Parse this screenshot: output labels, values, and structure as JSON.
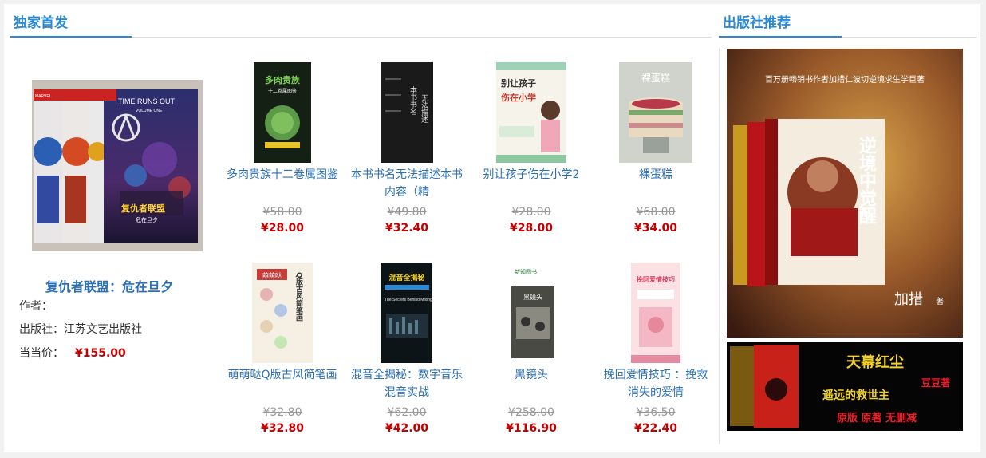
{
  "sections": {
    "exclusive_title": "独家首发",
    "publisher_title": "出版社推荐"
  },
  "feature": {
    "title": "复仇者联盟：危在旦夕",
    "author_label": "作者：",
    "author_value": "",
    "publisher_label": "出版社：",
    "publisher_value": "江苏文艺出版社",
    "price_label": "当当价：",
    "price": "¥155.00",
    "cover_text": {
      "brand": "MARVEL",
      "headline": "TIME RUNS OUT",
      "volume": "VOLUME ONE",
      "cn_title": "复仇者联盟",
      "cn_sub": "危在旦夕"
    }
  },
  "books": [
    {
      "name": "多肉贵族十二卷属图鉴",
      "old_price": "¥58.00",
      "price": "¥28.00",
      "cover_title": "多肉贵族",
      "cover_sub": "十二卷属图鉴",
      "color": "#152015",
      "accent": "#74b35a"
    },
    {
      "name": "本书书名无法描述本书内容（精",
      "old_price": "¥49.80",
      "price": "¥32.40",
      "cover_title": "本书书名",
      "cover_sub": "无法描述",
      "color": "#1a1a1a",
      "accent": "#dddddd"
    },
    {
      "name": "别让孩子伤在小学2",
      "old_price": "¥28.00",
      "price": "¥28.00",
      "cover_title": "别让孩子",
      "cover_sub": "伤在小学",
      "color": "#f6f3ea",
      "accent": "#c0392b"
    },
    {
      "name": "裸蛋糕",
      "old_price": "¥68.00",
      "price": "¥34.00",
      "cover_title": "裸蛋糕",
      "cover_sub": "",
      "color": "#cfd3cc",
      "accent": "#ffffff"
    },
    {
      "name": "萌萌哒Q版古风简笔画",
      "old_price": "¥32.80",
      "price": "¥32.80",
      "cover_title": "Q版古风简笔画",
      "cover_sub": "萌萌哒",
      "color": "#f6efe4",
      "accent": "#b0303a"
    },
    {
      "name": "混音全揭秘：数字音乐混音实战",
      "old_price": "¥62.00",
      "price": "¥42.00",
      "cover_title": "混音全揭秘",
      "cover_sub": "The Secrets Behind Mixing",
      "color": "#0d1418",
      "accent": "#f2d02b"
    },
    {
      "name": "黑镜头",
      "old_price": "¥258.00",
      "price": "¥116.90",
      "cover_title": "黑镜头",
      "cover_sub": "新知图书",
      "color": "#e9e9e2",
      "accent": "#333333"
    },
    {
      "name": "挽回爱情技巧 ：挽救消失的爱情",
      "old_price": "¥36.50",
      "price": "¥22.40",
      "cover_title": "挽回爱情技巧",
      "cover_sub": "",
      "color": "#fbe0e4",
      "accent": "#d23a58"
    }
  ],
  "ads": {
    "ad1": {
      "top_text": "百万册畅销书作者加措仁波切逆境求生学巨著",
      "title": "逆境中觉醒",
      "author": "加措",
      "note": "著"
    },
    "ad2": {
      "title": "天幕红尘",
      "sub": "遥远的救世主",
      "author": "豆豆著",
      "tag": "原版 原著 无删减"
    }
  }
}
